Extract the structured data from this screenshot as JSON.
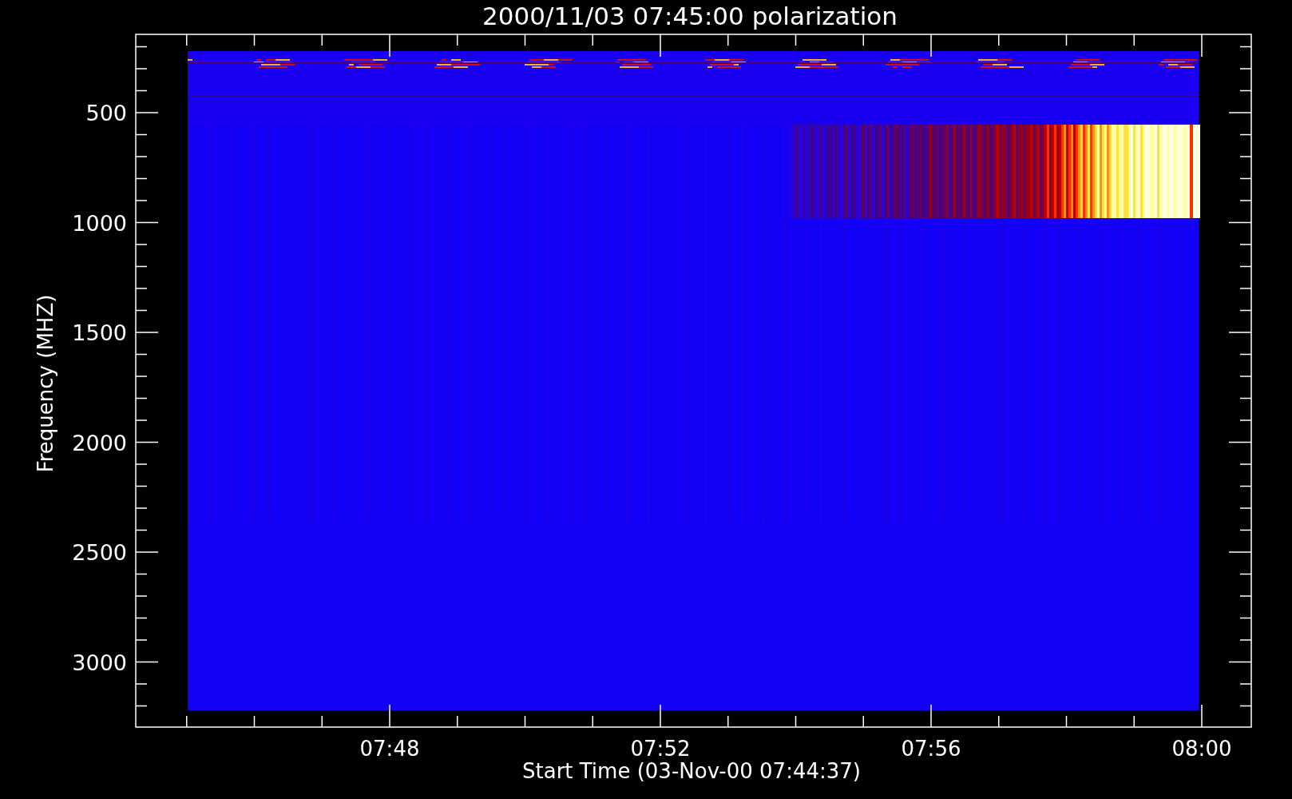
{
  "title": "2000/11/03 07:45:00 polarization",
  "plot": {
    "ylabel": "Frequency (MHZ)",
    "xlabel": "Start Time (03-Nov-00 07:44:37)",
    "y_tick_labels": [
      "500",
      "1000",
      "1500",
      "2000",
      "2500",
      "3000"
    ],
    "x_tick_labels": [
      "07:48",
      "07:52",
      "07:56",
      "08:00"
    ]
  }
}
